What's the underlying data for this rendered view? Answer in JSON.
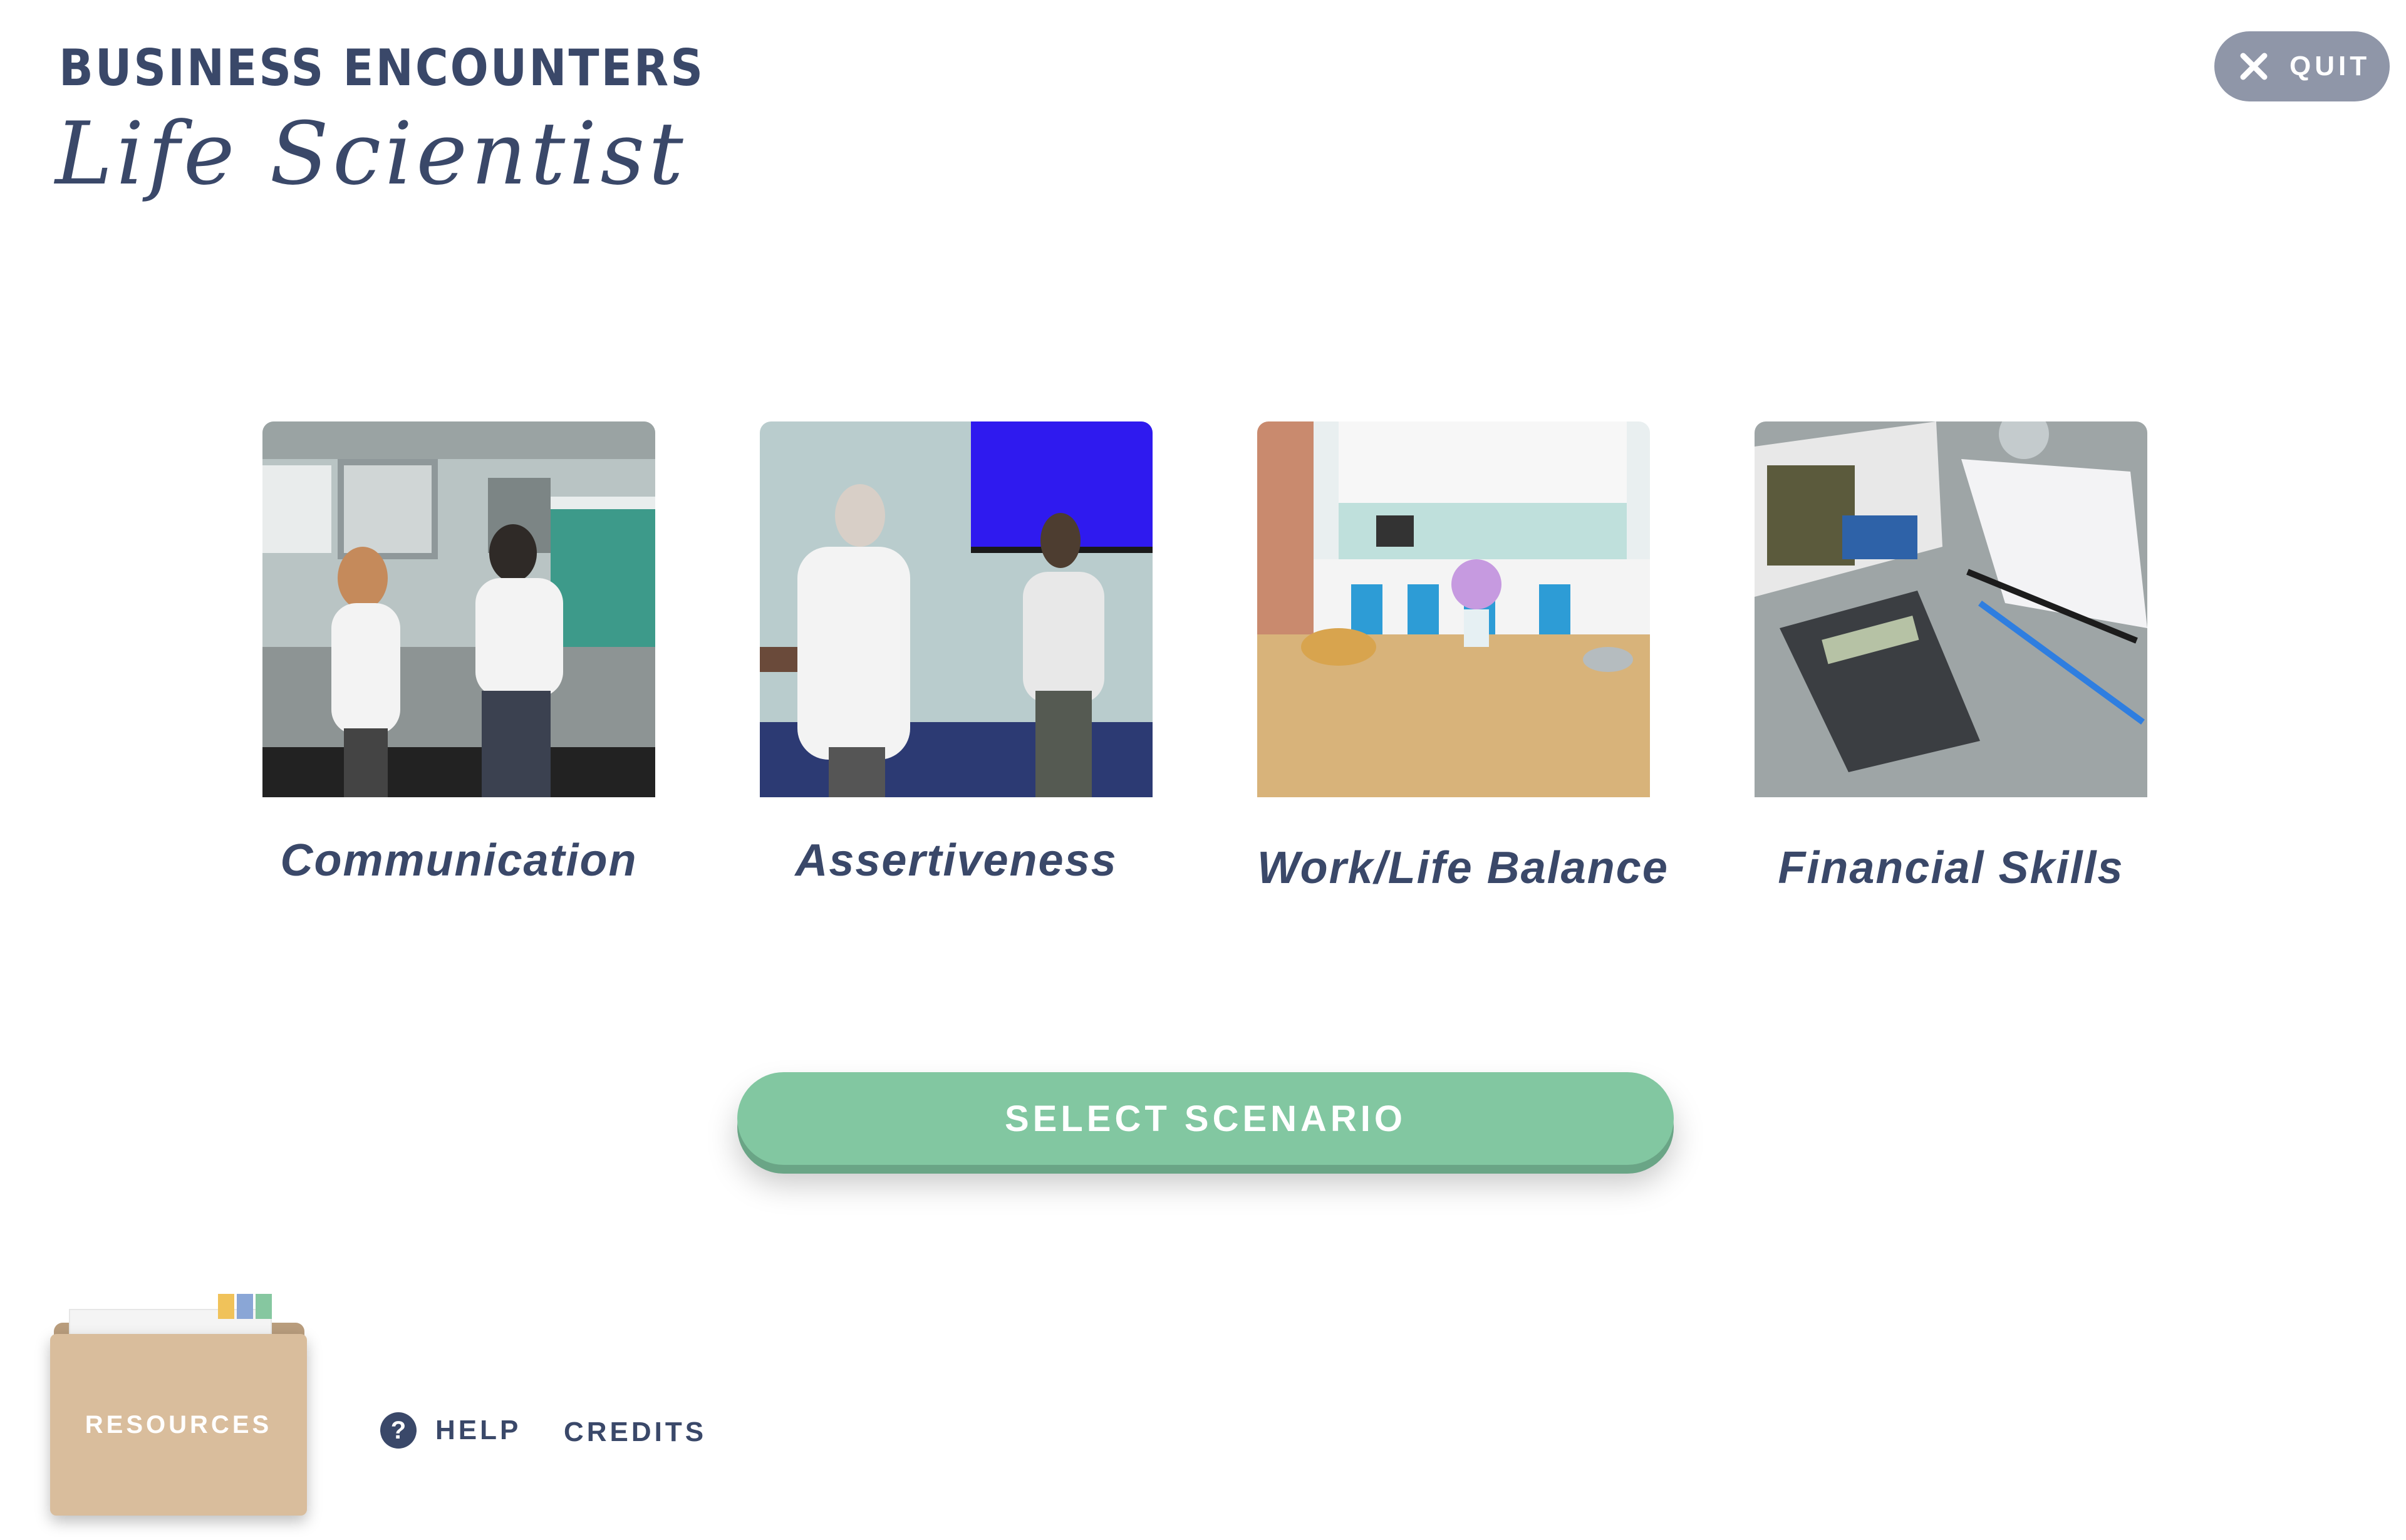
{
  "header": {
    "brand": "BUSINESS ENCOUNTERS",
    "subtitle": "Life Scientist"
  },
  "quit": {
    "label": "QUIT",
    "icon": "close-icon"
  },
  "scenarios": [
    {
      "label": "Communication",
      "image": "lab-conversation-thumbnail"
    },
    {
      "label": "Assertiveness",
      "image": "office-conversation-thumbnail"
    },
    {
      "label": "Work/Life Balance",
      "image": "kitchen-table-thumbnail"
    },
    {
      "label": "Financial Skills",
      "image": "calculator-desk-thumbnail"
    }
  ],
  "select_button": {
    "label": "SELECT SCENARIO"
  },
  "resources": {
    "label": "RESOURCES"
  },
  "footer": {
    "help_label": "HELP",
    "credits_label": "CREDITS"
  },
  "colors": {
    "text": "#3a4869",
    "accent_green": "#82c7a1",
    "quit_bg": "#8f96a8",
    "folder": "#d9bd9c"
  }
}
